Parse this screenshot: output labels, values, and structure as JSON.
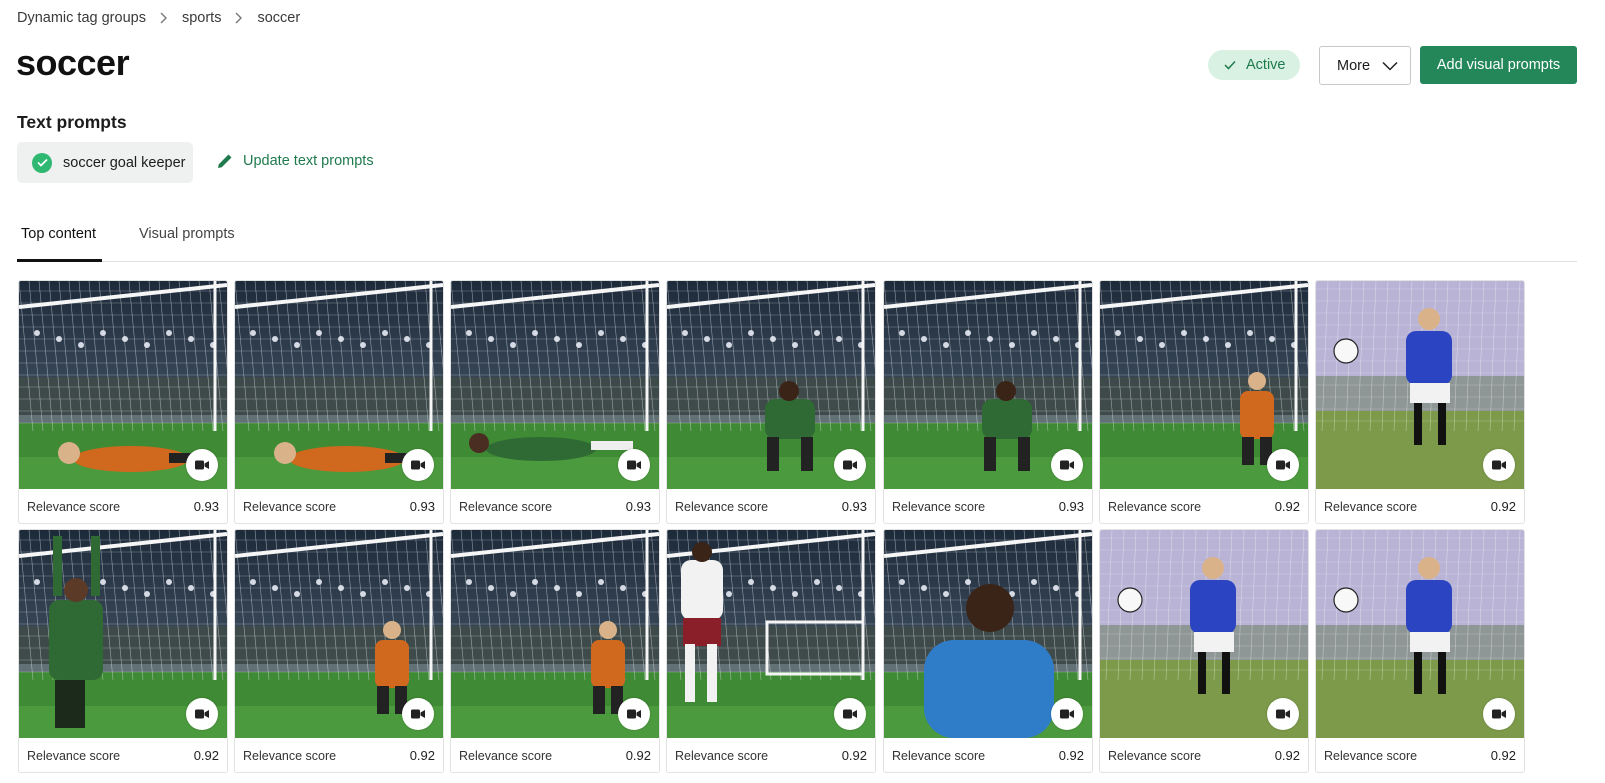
{
  "breadcrumb": [
    "Dynamic tag groups",
    "sports",
    "soccer"
  ],
  "title": "soccer",
  "status": "Active",
  "actions": {
    "more": "More",
    "add": "Add visual prompts"
  },
  "text_prompts": {
    "heading": "Text prompts",
    "chip": "soccer goal keeper",
    "update_link": "Update text prompts"
  },
  "tabs": [
    "Top content",
    "Visual prompts"
  ],
  "colors": {
    "accent": "#23875a",
    "active_badge_bg": "#d8f1e2",
    "check": "#2eb872"
  },
  "cards": [
    {
      "label": "Relevance score",
      "score": "0.93",
      "scene": "stadium-keeper-dive-orange",
      "icon": "video-camera-icon"
    },
    {
      "label": "Relevance score",
      "score": "0.93",
      "scene": "stadium-keeper-dive-orange",
      "icon": "video-camera-icon"
    },
    {
      "label": "Relevance score",
      "score": "0.93",
      "scene": "stadium-keeper-lying-green",
      "icon": "video-camera-icon"
    },
    {
      "label": "Relevance score",
      "score": "0.93",
      "scene": "stadium-keeper-crouch-green",
      "icon": "video-camera-icon"
    },
    {
      "label": "Relevance score",
      "score": "0.93",
      "scene": "stadium-keeper-kneel-green",
      "icon": "video-camera-icon"
    },
    {
      "label": "Relevance score",
      "score": "0.92",
      "scene": "stadium-keeper-far-orange",
      "icon": "video-camera-icon"
    },
    {
      "label": "Relevance score",
      "score": "0.92",
      "scene": "field-keeper-save-blue",
      "icon": "video-camera-icon"
    },
    {
      "label": "Relevance score",
      "score": "0.92",
      "scene": "stadium-keeper-arms-up-green",
      "icon": "video-camera-icon"
    },
    {
      "label": "Relevance score",
      "score": "0.92",
      "scene": "stadium-keeper-ready-orange",
      "icon": "video-camera-icon"
    },
    {
      "label": "Relevance score",
      "score": "0.92",
      "scene": "stadium-keeper-ready-orange",
      "icon": "video-camera-icon"
    },
    {
      "label": "Relevance score",
      "score": "0.92",
      "scene": "stadium-penalty-kick",
      "icon": "video-camera-icon"
    },
    {
      "label": "Relevance score",
      "score": "0.92",
      "scene": "stadium-keeper-celebrate-blue",
      "icon": "video-camera-icon"
    },
    {
      "label": "Relevance score",
      "score": "0.92",
      "scene": "field-keeper-dive-blue",
      "icon": "video-camera-icon"
    },
    {
      "label": "Relevance score",
      "score": "0.92",
      "scene": "field-keeper-catch-blue",
      "icon": "video-camera-icon"
    }
  ]
}
